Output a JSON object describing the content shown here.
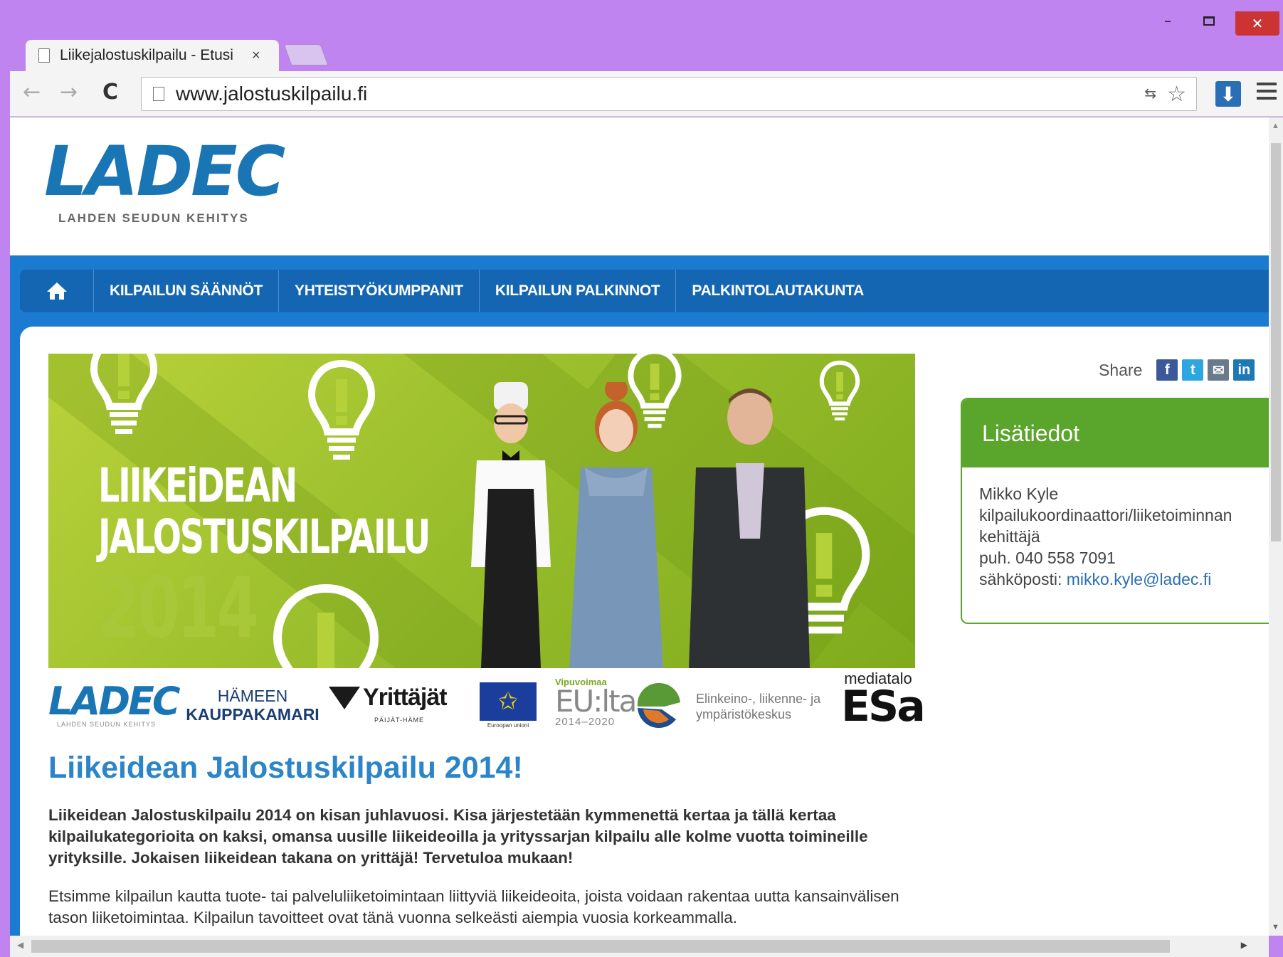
{
  "browser": {
    "tab_title": "Liikejalostuskilpailu - Etusi",
    "tab_close": "×",
    "url": "www.jalostuskilpailu.fi",
    "back": "←",
    "forward": "→",
    "reload": "C",
    "win_min": "–",
    "win_close": "✕",
    "download": "⬇",
    "star": "☆",
    "translate": "⇆"
  },
  "site": {
    "logo": "LADEC",
    "logo_sub": "LAHDEN SEUDUN KEHITYS",
    "nav": [
      "KILPAILUN SÄÄNNÖT",
      "YHTEISTYÖKUMPPANIT",
      "KILPAILUN PALKINNOT",
      "PALKINTOLAUTAKUNTA"
    ],
    "banner": {
      "line1": "LIIKEiDEAN",
      "line2": "JALOSTUSKILPAILU",
      "year": "2014"
    },
    "sponsors": {
      "ladec": "LADEC",
      "ladec_sub": "LAHDEN SEUDUN KEHITYS",
      "hameen_1": "HÄMEEN",
      "hameen_2": "KAUPPAKAMARI",
      "yrittajat": "Yrittäjät",
      "yrittajat_sub": "PÄIJÄT-HÄME",
      "eu_stars": "✩",
      "eu_sub": "Euroopan unioni",
      "vipu_1": "Vipuvoimaa",
      "vipu_2": "EU:lta",
      "vipu_3": "2014–2020",
      "ely": "Elinkeino-, liikenne- ja ympäristökeskus",
      "esa_1": "mediatalo",
      "esa_2": "ESa"
    },
    "heading": "Liikeidean Jalostuskilpailu 2014!",
    "lead": "Liikeidean Jalostuskilpailu 2014 on kisan juhlavuosi. Kisa järjestetään kymmenettä kertaa ja tällä kertaa kilpailukategorioita on kaksi, omansa uusille liikeideoilla ja yrityssarjan kilpailu alle kolme vuotta toimineille yrityksille. Jokaisen liikeidean takana on yrittäjä! Tervetuloa mukaan!",
    "para": "Etsimme kilpailun kautta tuote- tai palveluliiketoimintaan liittyviä liikeideoita, joista voidaan rakentaa uutta kansainvälisen tason liiketoimintaa. Kilpailun tavoitteet ovat tänä vuonna selkeästi aiempia vuosia korkeammalla.",
    "share_label": "Share",
    "share": {
      "fb": "f",
      "tw": "t",
      "mail": "✉",
      "in": "in"
    },
    "info": {
      "title": "Lisätiedot",
      "name": "Mikko Kyle",
      "role": "kilpailukoordinaattori/liiketoiminnan kehittäjä",
      "phone": "puh. 040 558 7091",
      "email_label": "sähköposti: ",
      "email": "mikko.kyle@ladec.fi"
    }
  },
  "colors": {
    "window_frame": "#c084f0",
    "brand_blue": "#1a75b4",
    "nav_blue": "#1566b2",
    "banner_green": "#95bb2a",
    "info_green": "#5aa52b",
    "heading_blue": "#2b85c8"
  }
}
